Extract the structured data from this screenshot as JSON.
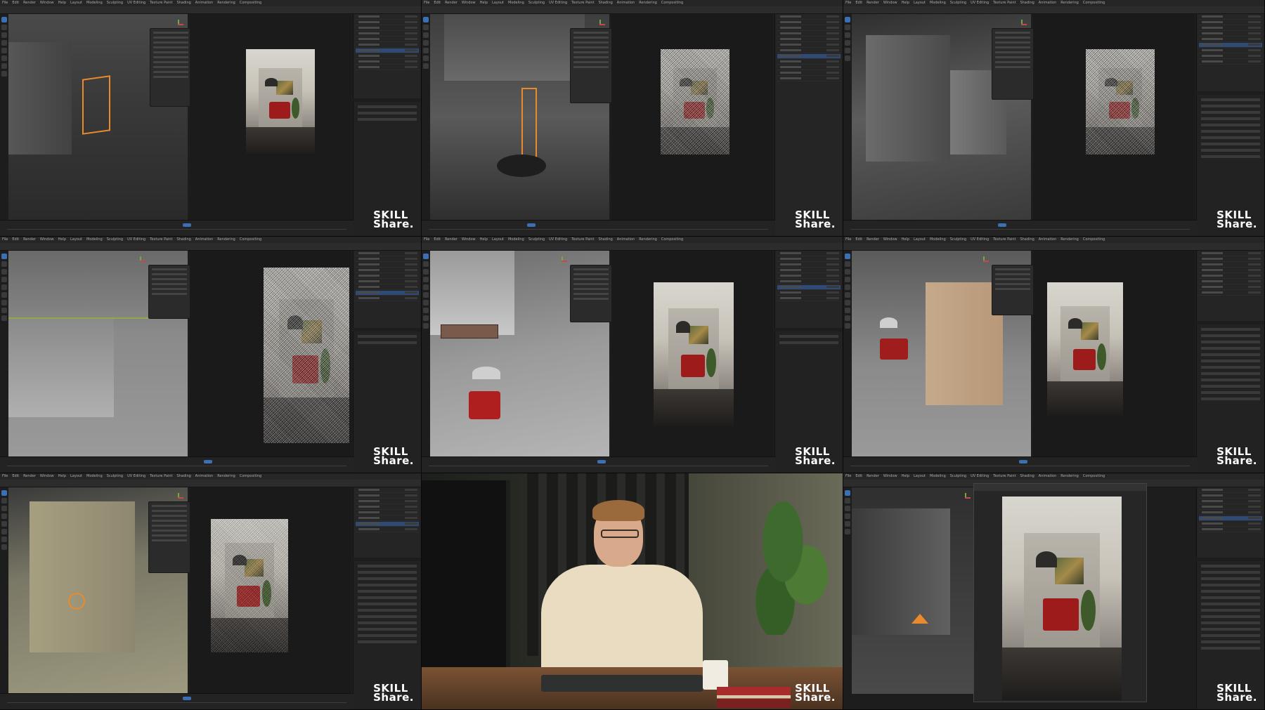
{
  "menus": [
    "File",
    "Edit",
    "Render",
    "Window",
    "Help",
    "Layout",
    "Modeling",
    "Sculpting",
    "UV Editing",
    "Texture Paint",
    "Shading",
    "Animation",
    "Rendering",
    "Compositing"
  ],
  "watermark": {
    "line1": "SKILL",
    "line2": "Share."
  },
  "tiles": [
    {
      "id": "t1",
      "variant": "editor-wireframe",
      "render_noisy": false
    },
    {
      "id": "t2",
      "variant": "editor-inside",
      "render_noisy": true
    },
    {
      "id": "t3",
      "variant": "editor-walls",
      "render_noisy": true
    },
    {
      "id": "t4",
      "variant": "editor-floor",
      "render_noisy": true
    },
    {
      "id": "t5",
      "variant": "editor-chair",
      "render_noisy": false
    },
    {
      "id": "t6",
      "variant": "editor-beige",
      "render_noisy": false
    },
    {
      "id": "t7",
      "variant": "editor-corner",
      "render_noisy": false
    },
    {
      "id": "t8",
      "variant": "instructor-camera"
    },
    {
      "id": "t9",
      "variant": "final-render"
    }
  ],
  "colors": {
    "selection": "#3c6fb4",
    "object_outline": "#e98a2c",
    "chair": "#9e1b1b",
    "ui_bg": "#1d1d1d"
  }
}
